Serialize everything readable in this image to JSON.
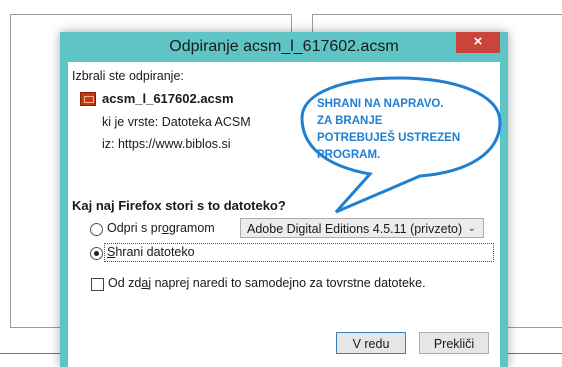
{
  "dialog": {
    "title": "Odpiranje acsm_l_617602.acsm",
    "close_glyph": "×",
    "intro": "Izbrali ste odpiranje:",
    "file_name": "acsm_l_617602.acsm",
    "file_type": "ki je vrste: Datoteka ACSM",
    "file_from": "iz: https://www.biblos.si",
    "question": "Kaj naj Firefox stori s to datoteko?",
    "open_with_label": "Odpri s programom",
    "open_with_app": "Adobe Digital Editions 4.5.11 (privzeto)",
    "save_label": "Shrani datoteko",
    "remember_label": "Od zdaj naprej naredi to samodejno za tovrstne datoteke.",
    "ok_label": "V redu",
    "cancel_label": "Prekliči",
    "accent_color": "#5ec4c6",
    "close_color": "#c9443b"
  },
  "callout": {
    "lines": [
      "SHRANI NA NAPRAVO.",
      "ZA BRANJE",
      "POTREBUJEŠ USTREZEN",
      "PROGRAM."
    ],
    "color": "#1f7fd0"
  }
}
